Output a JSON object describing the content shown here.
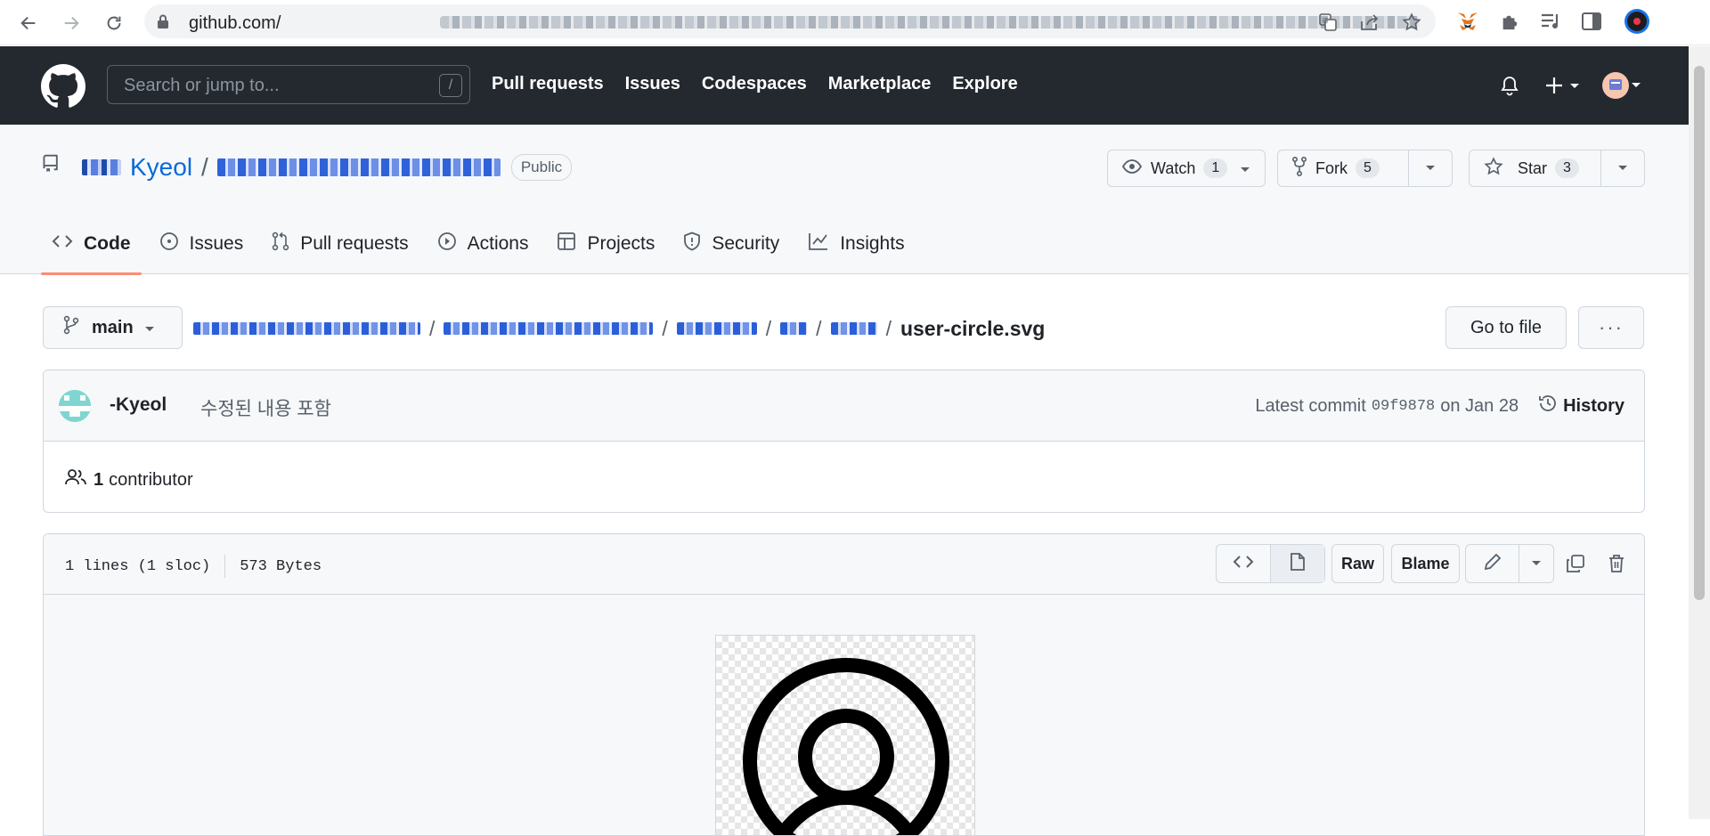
{
  "browser": {
    "url_prefix": "github.com/",
    "icons": [
      "back-icon",
      "forward-icon",
      "reload-icon",
      "lock-icon",
      "translate-icon",
      "share-icon",
      "bookmark-star-icon",
      "metamask-fox-icon",
      "extensions-puzzle-icon",
      "reading-list-icon",
      "side-panel-icon",
      "profile-icon"
    ]
  },
  "header": {
    "search_placeholder": "Search or jump to...",
    "search_shortcut": "/",
    "nav": [
      "Pull requests",
      "Issues",
      "Codespaces",
      "Marketplace",
      "Explore"
    ]
  },
  "repo": {
    "owner": "Kyeol",
    "separator": "/",
    "visibility": "Public",
    "watch_label": "Watch",
    "watch_count": "1",
    "fork_label": "Fork",
    "fork_count": "5",
    "star_label": "Star",
    "star_count": "3",
    "tabs": [
      "Code",
      "Issues",
      "Pull requests",
      "Actions",
      "Projects",
      "Security",
      "Insights"
    ]
  },
  "path": {
    "branch": "main",
    "separator": "/",
    "filename": "user-circle.svg",
    "goto_label": "Go to file",
    "more_label": "···"
  },
  "commit": {
    "author": "-Kyeol",
    "message": "수정된 내용 포함",
    "latest_label": "Latest commit",
    "sha": "09f9878",
    "date": "on Jan 28",
    "history_label": "History",
    "contributors_count": "1",
    "contributors_label": "contributor"
  },
  "file": {
    "lines": "1 lines (1 sloc)",
    "size": "573 Bytes",
    "raw_label": "Raw",
    "blame_label": "Blame"
  },
  "colors": {
    "header_bg": "#24292f",
    "link": "#0969da",
    "active_tab_underline": "#fd8c73"
  }
}
